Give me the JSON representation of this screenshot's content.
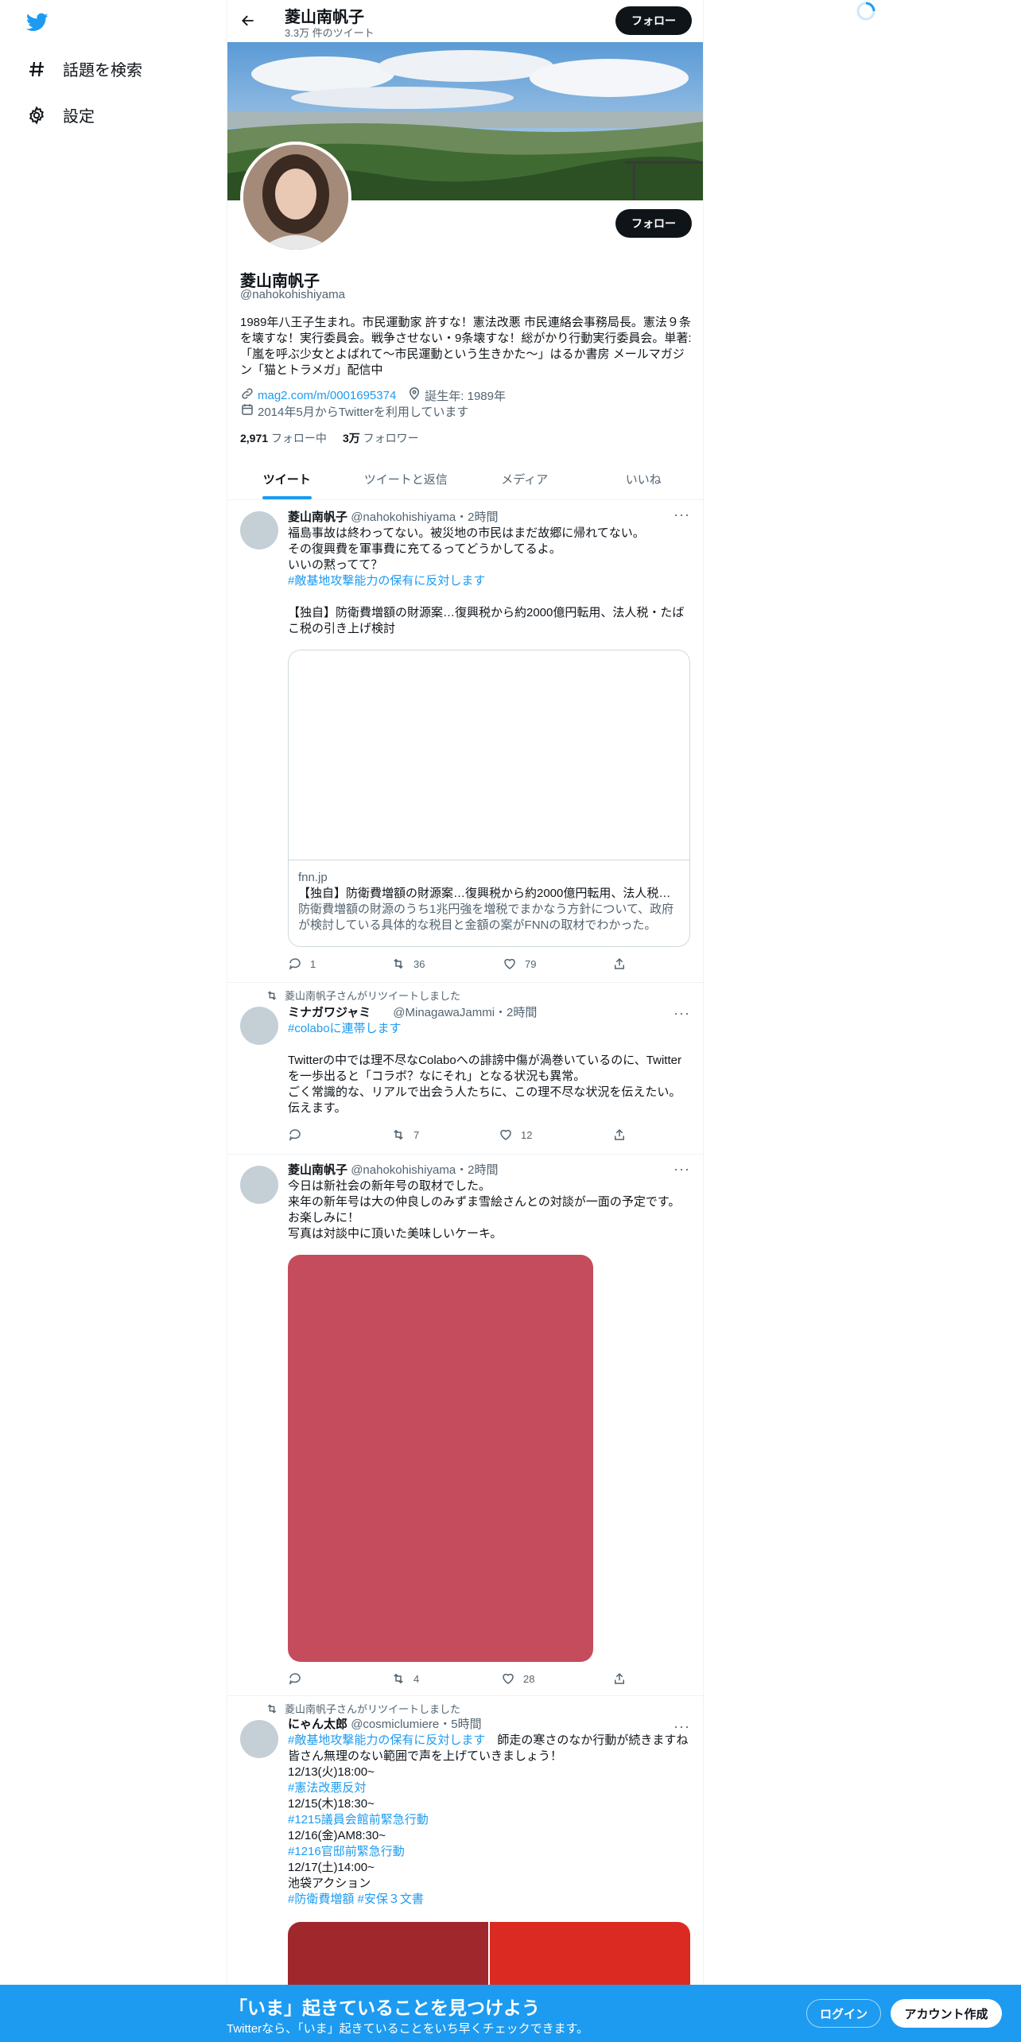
{
  "nav": {
    "items": [
      {
        "label": "話題を検索",
        "icon": "hashtag-icon"
      },
      {
        "label": "設定",
        "icon": "gear-icon"
      }
    ]
  },
  "header": {
    "name": "菱山南帆子",
    "tweet_count": "3.3万 件のツイート",
    "follow_label": "フォロー"
  },
  "profile": {
    "name": "菱山南帆子",
    "handle": "@nahokohishiyama",
    "follow_label": "フォロー",
    "bio": "1989年八王子生まれ。市民運動家 許すな！憲法改悪 市民連絡会事務局長。憲法９条を壊すな！実行委員会。戦争させない・9条壊すな！総がかり行動実行委員会。単著:「嵐を呼ぶ少女とよばれて〜市民運動という生きかた〜」はるか書房 メールマガジン「猫とトラメガ」配信中",
    "link": "mag2.com/m/0001695374",
    "birth": "誕生年: 1989年",
    "joined": "2014年5月からTwitterを利用しています",
    "following_count": "2,971",
    "following_label": "フォロー中",
    "followers_count": "3万",
    "followers_label": "フォロワー"
  },
  "tabs": [
    "ツイート",
    "ツイートと返信",
    "メディア",
    "いいね"
  ],
  "tweets": [
    {
      "name": "菱山南帆子",
      "handle": "@nahokohishiyama",
      "time": "・2時間",
      "lines": [
        "福島事故は終わってない。被災地の市民はまだ故郷に帰れてない。",
        "その復興費を軍事費に充てるってどうかしてるよ。",
        "いいの黙ってて？"
      ],
      "hashtag": "#敵基地攻撃能力の保有に反対します",
      "quote": "【独自】防衛費増額の財源案…復興税から約2000億円転用、法人税・たばこ税の引き上げ検討",
      "card_domain": "fnn.jp",
      "card_title": "【独自】防衛費増額の財源案…復興税から約2000億円転用、法人税・…",
      "card_desc": "防衛費増額の財源のうち1兆円強を増税でまかなう方針について、政府が検討している具体的な税目と金額の案がFNNの取材でわかった。東…",
      "reply": "1",
      "retweet": "36",
      "like": "79"
    },
    {
      "rt_label": "菱山南帆子さんがリツイートしました",
      "name": "ミナガワジャミ",
      "handle": "@MinagawaJammi",
      "time": "・2時間",
      "hashtag": "#colaboに連帯します",
      "lines": [
        "Twitterの中では理不尽なColaboへの誹謗中傷が渦巻いているのに、Twitterを一歩出ると「コラボ？なにそれ」となる状況も異常。",
        "ごく常識的な、リアルで出会う人たちに、この理不尽な状況を伝えたい。伝えます。"
      ],
      "reply": "",
      "retweet": "7",
      "like": "12"
    },
    {
      "name": "菱山南帆子",
      "handle": "@nahokohishiyama",
      "time": "・2時間",
      "lines": [
        "今日は新社会の新年号の取材でした。",
        "来年の新年号は大の仲良しのみずま雪絵さんとの対談が一面の予定です。",
        "お楽しみに！",
        "写真は対談中に頂いた美味しいケーキ。"
      ],
      "reply": "",
      "retweet": "4",
      "like": "28"
    },
    {
      "rt_label": "菱山南帆子さんがリツイートしました",
      "name": "にゃん太郎",
      "handle": "@cosmiclumiere",
      "time": "・5時間",
      "hashtag1": "#敵基地攻撃能力の保有に反対します",
      "line1a": "　師走の寒さのなか行動が続きますね　皆さん無理のない範囲で声を上げていきましょう！",
      "d1": "12/13(火)18:00~",
      "h1": "#憲法改悪反対",
      "d2": "12/15(木)18:30~",
      "h2": "#1215議員会館前緊急行動",
      "d3": "12/16(金)AM8:30~",
      "h3": "#1216官邸前緊急行動",
      "d4": "12/17(土)14:00~",
      "l4": "池袋アクション",
      "h4": "#防衛費増額",
      "h5": "#安保３文書"
    }
  ],
  "bottom": {
    "title": "「いま」起きていることを見つけよう",
    "subtitle": "Twitterなら、「いま」起きていることをいち早くチェックできます。",
    "login": "ログイン",
    "signup": "アカウント作成"
  },
  "colors": {
    "accent": "#1d9bf0",
    "cake": "#c44c5c",
    "image_left": "#a0282c",
    "image_right": "#db2a22"
  }
}
